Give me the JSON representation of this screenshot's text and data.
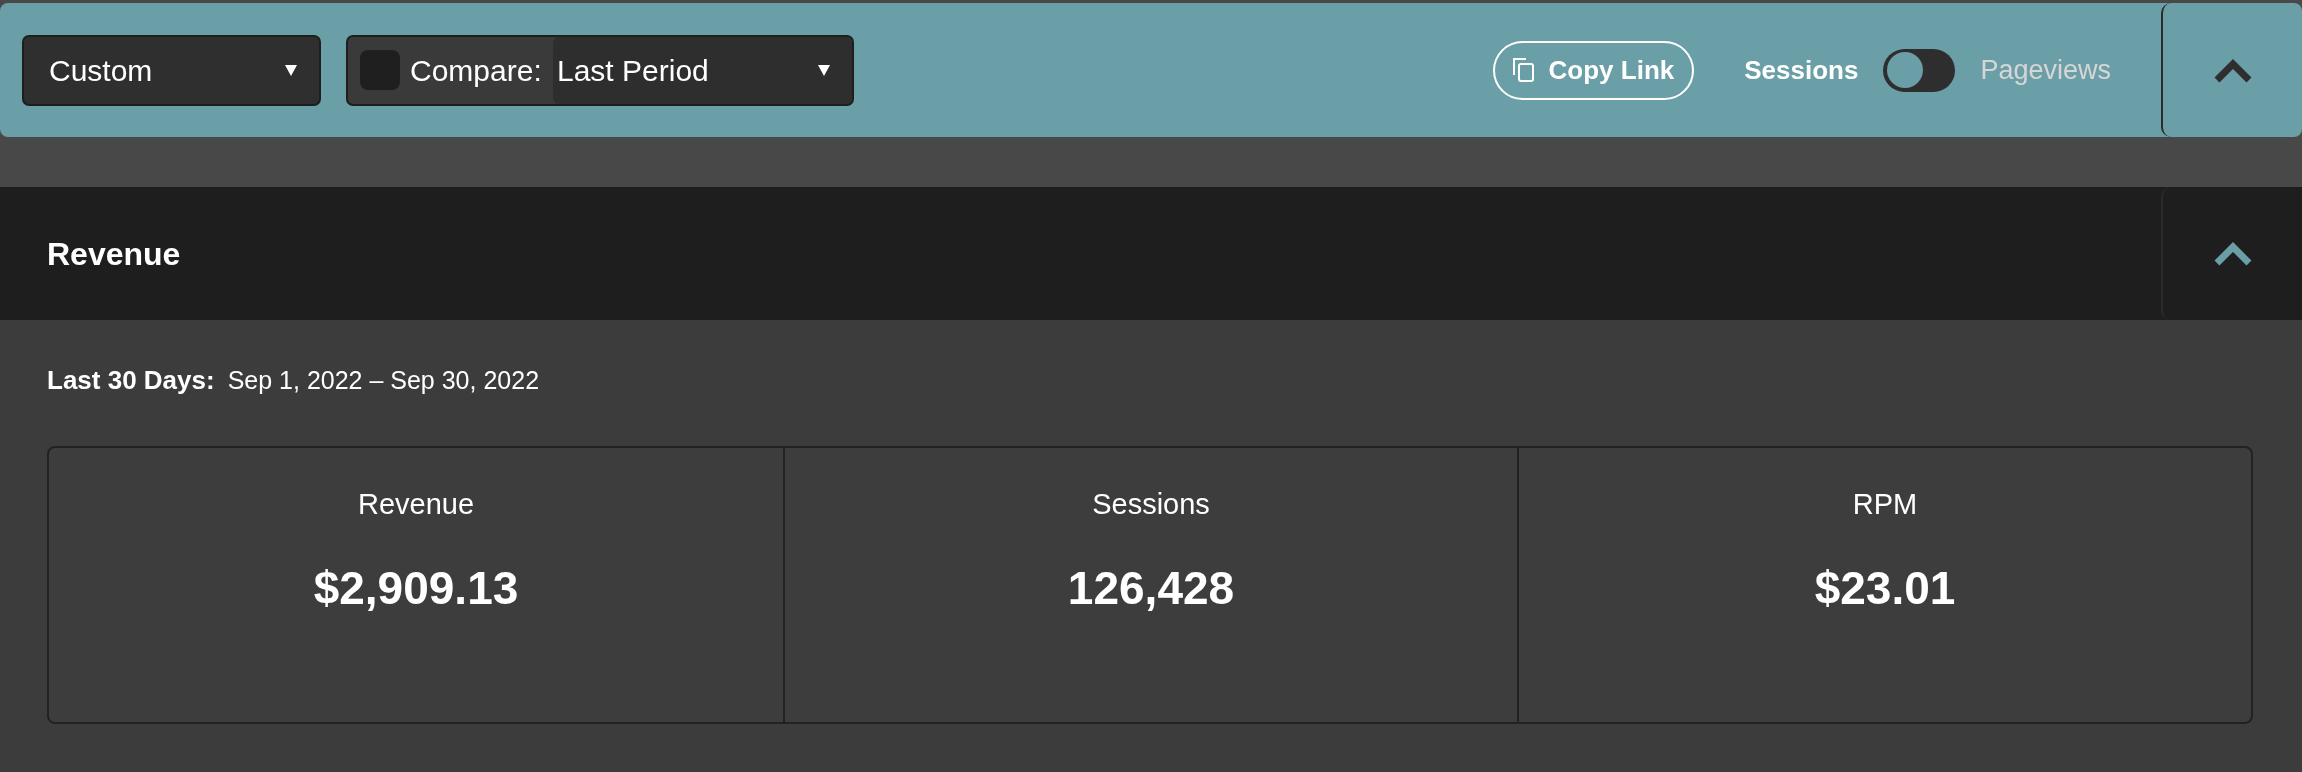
{
  "toolbar": {
    "date_range": {
      "value": "Custom"
    },
    "compare": {
      "checked": false,
      "label": "Compare:",
      "value": "Last Period"
    },
    "copy_link": {
      "label": "Copy Link"
    },
    "metric_toggle": {
      "options": [
        {
          "label": "Sessions",
          "selected": true
        },
        {
          "label": "Pageviews",
          "selected": false
        }
      ]
    },
    "expanded": true
  },
  "panel": {
    "title": "Revenue",
    "expanded": true,
    "period": {
      "label": "Last 30 Days:",
      "range": "Sep 1, 2022 – Sep 30, 2022"
    },
    "metrics": [
      {
        "label": "Revenue",
        "value": "$2,909.13"
      },
      {
        "label": "Sessions",
        "value": "126,428"
      },
      {
        "label": "RPM",
        "value": "$23.01"
      }
    ]
  }
}
